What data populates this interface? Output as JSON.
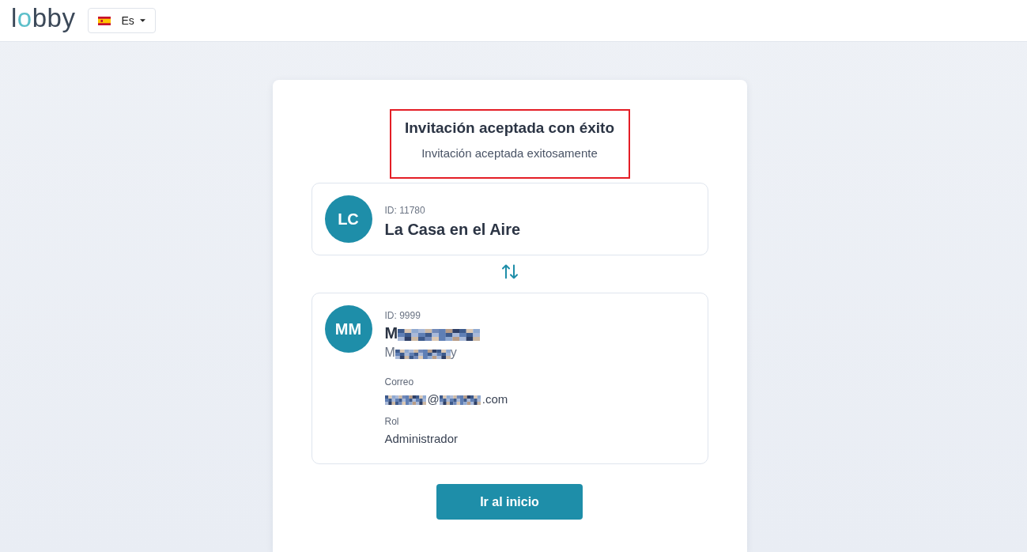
{
  "header": {
    "logo": "lobby",
    "language": {
      "label": "Es"
    }
  },
  "result": {
    "title": "Invitación aceptada con éxito",
    "subtitle": "Invitación aceptada exitosamente",
    "highlighted": true
  },
  "property": {
    "initials": "LC",
    "id": "ID: 11780",
    "name": "La Casa en el Aire"
  },
  "member": {
    "initials": "MM",
    "id": "ID: 9999",
    "name": [
      {
        "kind": "text",
        "text": "M"
      },
      {
        "kind": "redacted"
      }
    ],
    "username": [
      {
        "kind": "text",
        "text": "M"
      },
      {
        "kind": "redacted"
      },
      {
        "kind": "text",
        "text": "y"
      }
    ],
    "fields": [
      {
        "label": "Correo",
        "value": [
          {
            "kind": "redacted"
          },
          {
            "kind": "text",
            "text": "@"
          },
          {
            "kind": "redacted"
          },
          {
            "kind": "text",
            "text": ".com"
          }
        ]
      },
      {
        "label": "Rol",
        "value": [
          {
            "kind": "text",
            "text": "Administrador"
          }
        ]
      }
    ]
  },
  "action": {
    "label": "Ir al inicio"
  }
}
